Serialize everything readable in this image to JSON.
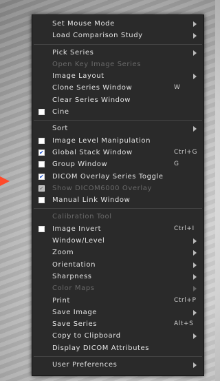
{
  "menu": {
    "groups": [
      [
        {
          "label": "Set Mouse Mode",
          "submenu": true
        },
        {
          "label": "Load Comparison Study",
          "submenu": true
        }
      ],
      [
        {
          "label": "Pick Series",
          "submenu": true
        },
        {
          "label": "Open Key Image Series",
          "disabled": true
        },
        {
          "label": "Image Layout",
          "submenu": true
        },
        {
          "label": "Clone Series Window",
          "shortcut": "W"
        },
        {
          "label": "Clear Series Window"
        },
        {
          "label": "Cine",
          "checkbox": true,
          "checked": false
        }
      ],
      [
        {
          "label": "Sort",
          "submenu": true
        },
        {
          "label": "Image Level Manipulation",
          "checkbox": true,
          "checked": false
        },
        {
          "label": "Global Stack Window",
          "checkbox": true,
          "checked": true,
          "shortcut": "Ctrl+G"
        },
        {
          "label": "Group Window",
          "checkbox": true,
          "checked": false,
          "shortcut": "G"
        },
        {
          "label": "DICOM Overlay Series Toggle",
          "checkbox": true,
          "checked": true
        },
        {
          "label": "Show DICOM6000 Overlay",
          "checkbox": true,
          "checked": true,
          "disabled": true
        },
        {
          "label": "Manual Link Window",
          "checkbox": true,
          "checked": false
        }
      ],
      [
        {
          "label": "Calibration Tool",
          "disabled": true
        },
        {
          "label": "Image Invert",
          "checkbox": true,
          "checked": false,
          "shortcut": "Ctrl+I"
        },
        {
          "label": "Window/Level",
          "submenu": true
        },
        {
          "label": "Zoom",
          "submenu": true
        },
        {
          "label": "Orientation",
          "submenu": true
        },
        {
          "label": "Sharpness",
          "submenu": true
        },
        {
          "label": "Color Maps",
          "submenu": true,
          "disabled": true
        },
        {
          "label": "Print",
          "shortcut": "Ctrl+P"
        },
        {
          "label": "Save Image",
          "submenu": true
        },
        {
          "label": "Save Series",
          "shortcut": "Alt+S"
        },
        {
          "label": "Copy to Clipboard",
          "submenu": true
        },
        {
          "label": "Display DICOM Attributes"
        }
      ],
      [
        {
          "label": "User Preferences",
          "submenu": true
        }
      ]
    ]
  },
  "checkmark_glyph": "✔",
  "colors": {
    "accent_arrow": "#ff4a2a",
    "menu_bg": "#2a2a2a"
  }
}
